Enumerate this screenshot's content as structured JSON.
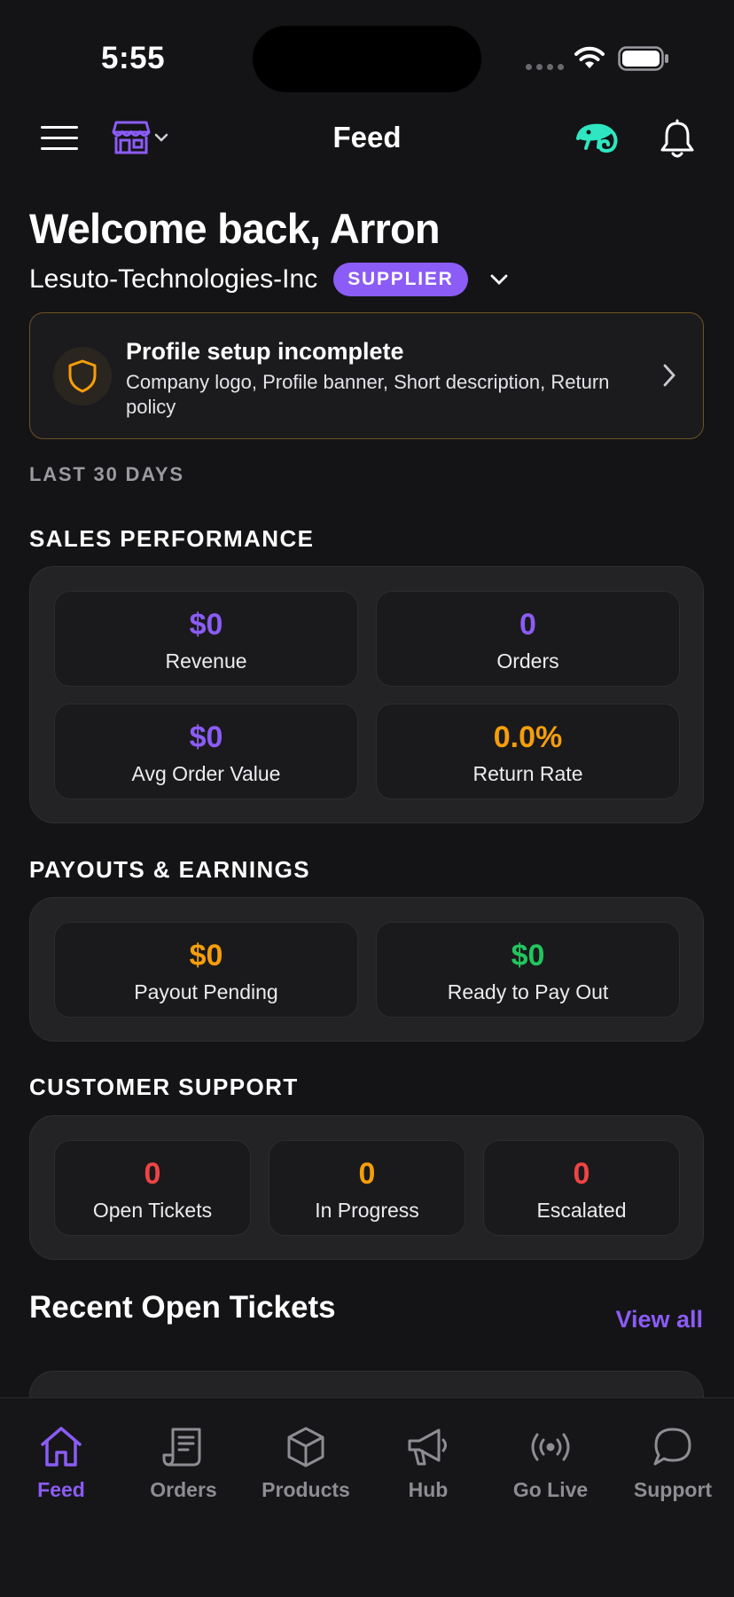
{
  "status_bar": {
    "time": "5:55"
  },
  "header": {
    "title": "Feed"
  },
  "welcome": {
    "greeting": "Welcome back, Arron",
    "company": "Lesuto-Technologies-Inc",
    "role_badge": "SUPPLIER"
  },
  "profile_alert": {
    "title": "Profile setup incomplete",
    "description": "Company logo, Profile banner, Short description, Return policy"
  },
  "date_range": "LAST 30 DAYS",
  "sales_performance": {
    "heading": "SALES PERFORMANCE",
    "stats": [
      {
        "value": "$0",
        "label": "Revenue",
        "color": "#8b5cf6"
      },
      {
        "value": "0",
        "label": "Orders",
        "color": "#8b5cf6"
      },
      {
        "value": "$0",
        "label": "Avg Order Value",
        "color": "#8b5cf6"
      },
      {
        "value": "0.0%",
        "label": "Return Rate",
        "color": "#f59e0b"
      }
    ]
  },
  "payouts": {
    "heading": "PAYOUTS & EARNINGS",
    "stats": [
      {
        "value": "$0",
        "label": "Payout Pending",
        "color": "#f59e0b"
      },
      {
        "value": "$0",
        "label": "Ready to Pay Out",
        "color": "#22c55e"
      }
    ]
  },
  "support": {
    "heading": "CUSTOMER SUPPORT",
    "stats": [
      {
        "value": "0",
        "label": "Open Tickets",
        "color": "#ef4444"
      },
      {
        "value": "0",
        "label": "In Progress",
        "color": "#f59e0b"
      },
      {
        "value": "0",
        "label": "Escalated",
        "color": "#ef4444"
      }
    ]
  },
  "recent_tickets": {
    "title": "Recent Open Tickets",
    "view_all": "View all"
  },
  "tab_bar": {
    "tabs": [
      {
        "label": "Feed",
        "icon": "home-icon",
        "active": true
      },
      {
        "label": "Orders",
        "icon": "receipt-icon",
        "active": false
      },
      {
        "label": "Products",
        "icon": "box-icon",
        "active": false
      },
      {
        "label": "Hub",
        "icon": "megaphone-icon",
        "active": false
      },
      {
        "label": "Go Live",
        "icon": "broadcast-icon",
        "active": false
      },
      {
        "label": "Support",
        "icon": "chat-bubble-icon",
        "active": false
      }
    ]
  },
  "colors": {
    "accent": "#8b5cf6",
    "warning": "#f59e0b",
    "success": "#22c55e",
    "danger": "#ef4444",
    "brand_mascot": "#2ee6c1"
  }
}
